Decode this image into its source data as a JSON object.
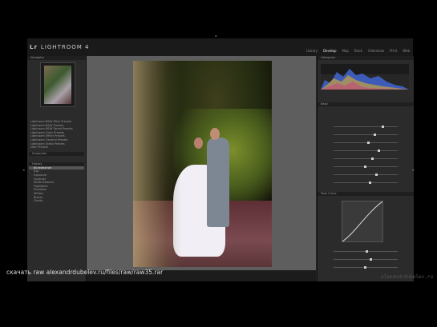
{
  "app": {
    "title": "LIGHTROOM 4",
    "logo": "Lr"
  },
  "modules": [
    "Library",
    "Develop",
    "Map",
    "Book",
    "Slideshow",
    "Print",
    "Web"
  ],
  "active_module": "Develop",
  "left_panel": {
    "navigator_label": "Navigator",
    "presets_label": "Presets",
    "snapshots_label": "Snapshots",
    "history_label": "History",
    "preset_items": [
      {
        "label": "Lightroom B&W Filter Presets",
        "type": "folder"
      },
      {
        "label": "Lightroom B&W Presets",
        "type": "folder"
      },
      {
        "label": "Lightroom B&W Toned Presets",
        "type": "folder"
      },
      {
        "label": "Lightroom Color Presets",
        "type": "folder"
      },
      {
        "label": "Lightroom Effect Presets",
        "type": "folder"
      },
      {
        "label": "Lightroom General Presets",
        "type": "folder"
      },
      {
        "label": "Lightroom Video Presets",
        "type": "folder"
      },
      {
        "label": "User Presets",
        "type": "folder"
      }
    ],
    "history_items": [
      "Вклеивание",
      "Exp",
      "Exposure",
      "Contrast",
      "White Balance",
      "Highlights",
      "Shadows",
      "Whites",
      "Blacks",
      "Clarity"
    ]
  },
  "right_panel": {
    "histogram_label": "Histogram",
    "basic_label": "Basic",
    "tone_curve_label": "Tone Curve"
  },
  "caption": "скачать raw alexandrdubelev.ru/files/raw/raw35.rar",
  "watermark": "alexandrdubelev.ru",
  "colors": {
    "accent": "#eeeeee",
    "panel": "#2b2b2b",
    "background": "#5e5e5e"
  }
}
